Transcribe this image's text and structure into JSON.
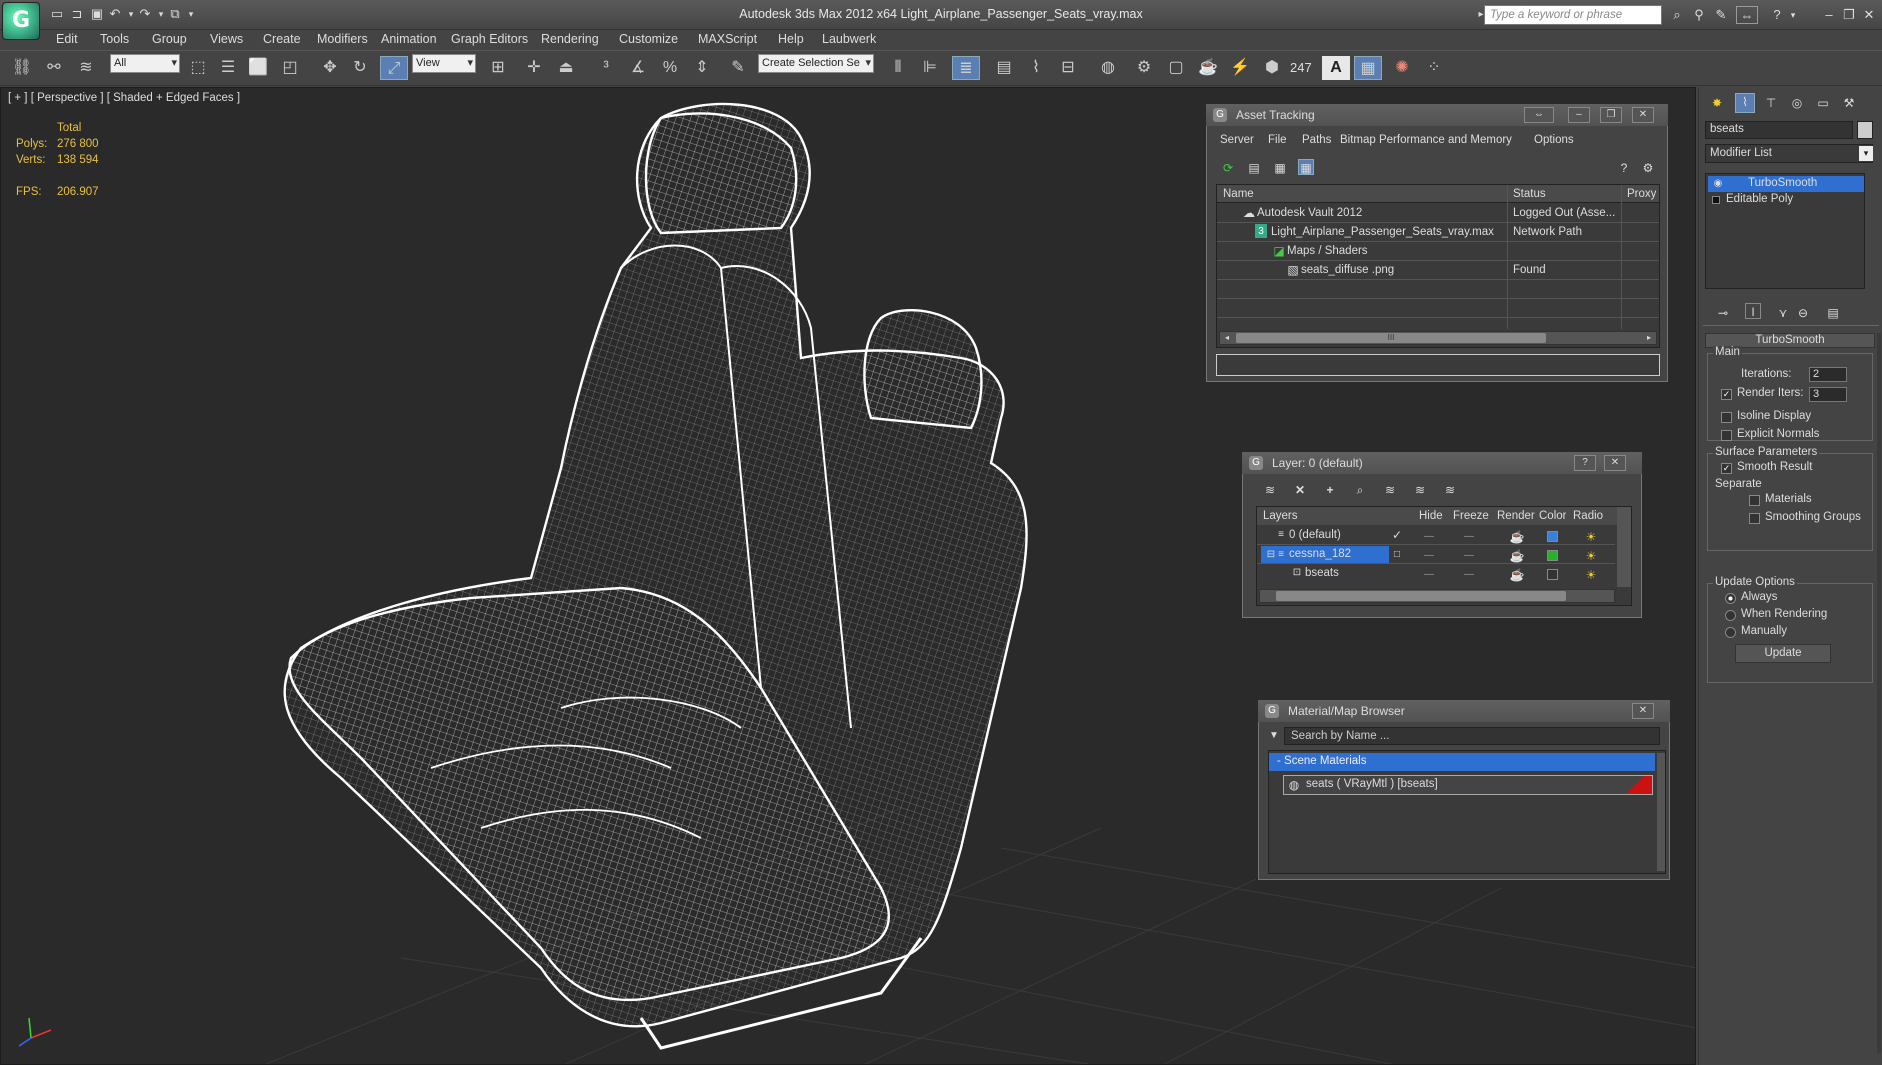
{
  "app": {
    "title": "Autodesk 3ds Max  2012 x64      Light_Airplane_Passenger_Seats_vray.max",
    "logo": "G"
  },
  "search": {
    "placeholder": "Type a keyword or phrase"
  },
  "menus": [
    "Edit",
    "Tools",
    "Group",
    "Views",
    "Create",
    "Modifiers",
    "Animation",
    "Graph Editors",
    "Rendering",
    "Customize",
    "MAXScript",
    "Help",
    "Laubwerk"
  ],
  "toolbar": {
    "selection_filter": "All",
    "ref_coord": "View",
    "named_selection": "Create Selection Se",
    "count_label": "247"
  },
  "viewport": {
    "label": "[ + ] [ Perspective ] [ Shaded + Edged Faces ]",
    "stats": {
      "total_label": "Total",
      "polys_label": "Polys:",
      "polys": "276 800",
      "verts_label": "Verts:",
      "verts": "138 594",
      "fps_label": "FPS:",
      "fps": "206.907"
    }
  },
  "asset_tracking": {
    "title": "Asset Tracking",
    "menus": [
      "Server",
      "File",
      "Paths",
      "Bitmap Performance and Memory",
      "Options"
    ],
    "columns": [
      "Name",
      "Status",
      "Proxy"
    ],
    "rows": [
      {
        "name": "Autodesk Vault 2012",
        "status": "Logged Out (Asse..."
      },
      {
        "name": "Light_Airplane_Passenger_Seats_vray.max",
        "status": "Network Path"
      },
      {
        "name": "Maps / Shaders",
        "status": ""
      },
      {
        "name": "seats_diffuse .png",
        "status": "Found"
      }
    ],
    "scroll_grip": "III"
  },
  "layer_manager": {
    "title": "Layer: 0 (default)",
    "help": "?",
    "columns": [
      "Layers",
      "Hide",
      "Freeze",
      "Render",
      "Color",
      "Radio"
    ],
    "rows": [
      {
        "name": "0 (default)",
        "color": "#3a7fd8",
        "checked": true
      },
      {
        "name": "cessna_182",
        "color": "#2ab02a",
        "selected": true
      },
      {
        "name": "bseats",
        "color": "#333333"
      }
    ]
  },
  "material_browser": {
    "title": "Material/Map Browser",
    "search_placeholder": "Search by Name ...",
    "group": "- Scene Materials",
    "material": "seats  ( VRayMtl )  [bseats]"
  },
  "command_panel": {
    "object_name": "bseats",
    "modifier_list": "Modifier List",
    "stack": [
      "TurboSmooth",
      "Editable Poly"
    ],
    "rollout_title": "TurboSmooth",
    "main_label": "Main",
    "iterations_label": "Iterations:",
    "iterations": "2",
    "render_iters_label": "Render Iters:",
    "render_iters": "3",
    "isoline": "Isoline Display",
    "explicit_normals": "Explicit Normals",
    "surface_params": "Surface Parameters",
    "smooth_result": "Smooth Result",
    "separate": "Separate",
    "materials": "Materials",
    "smoothing_groups": "Smoothing Groups",
    "update_options": "Update Options",
    "always": "Always",
    "when_rendering": "When Rendering",
    "manually": "Manually",
    "update_button": "Update"
  },
  "colors": {
    "selection_blue": "#2f6fd0",
    "stat_yellow": "#e8c040",
    "material_red": "#cc1111"
  }
}
